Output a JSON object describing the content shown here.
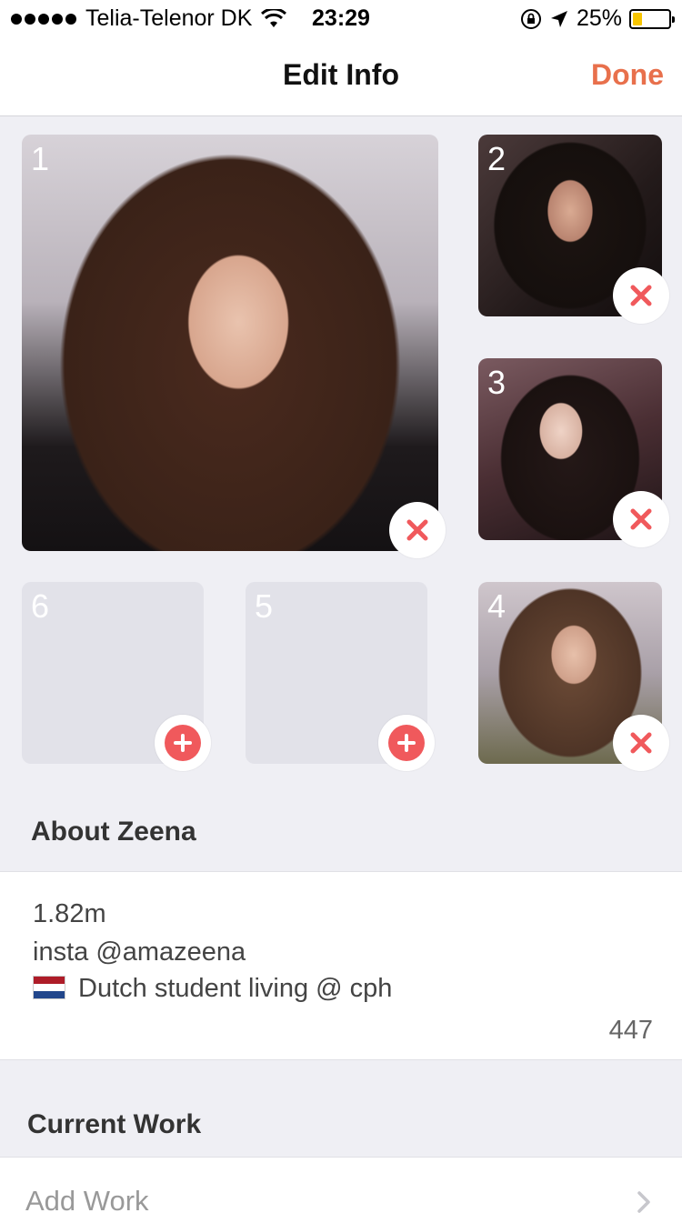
{
  "status_bar": {
    "carrier": "Telia-Telenor DK",
    "time": "23:29",
    "battery": "25%",
    "battery_level": 0.25
  },
  "nav": {
    "title": "Edit Info",
    "done_label": "Done"
  },
  "photos": [
    {
      "slot": "1",
      "state": "photo",
      "action_icon": "remove-x-icon"
    },
    {
      "slot": "2",
      "state": "photo",
      "action_icon": "remove-x-icon"
    },
    {
      "slot": "3",
      "state": "photo",
      "action_icon": "remove-x-icon"
    },
    {
      "slot": "4",
      "state": "photo",
      "action_icon": "remove-x-icon"
    },
    {
      "slot": "5",
      "state": "empty",
      "action_icon": "add-plus-icon"
    },
    {
      "slot": "6",
      "state": "empty",
      "action_icon": "add-plus-icon"
    }
  ],
  "about": {
    "heading": "About Zeena",
    "lines": [
      "1.82m",
      "insta @amazeena",
      "Dutch student living @ cph"
    ],
    "flag_icon": "netherlands-flag-icon",
    "remaining_chars": "447"
  },
  "work": {
    "heading": "Current Work",
    "placeholder": "Add Work"
  },
  "colors": {
    "accent": "#e8704c",
    "remove": "#f0595c",
    "background": "#efeff4"
  }
}
